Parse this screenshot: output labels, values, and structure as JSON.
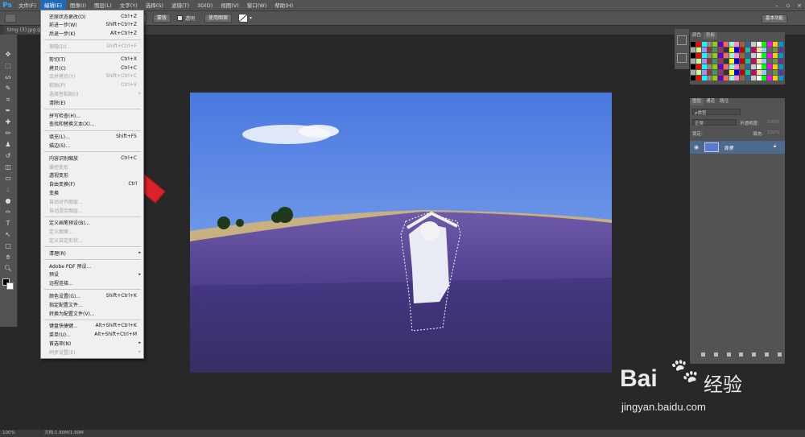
{
  "app": {
    "logo": "Ps",
    "window_controls": [
      "–",
      "▫",
      "×"
    ]
  },
  "menubar": [
    "文件(F)",
    "编辑(E)",
    "图像(I)",
    "图层(L)",
    "文字(Y)",
    "选择(S)",
    "滤镜(T)",
    "3D(D)",
    "视图(V)",
    "窗口(W)",
    "帮助(H)"
  ],
  "options": {
    "btn_blur": "调整边缘...",
    "mask": "蒙版",
    "invert": "反相",
    "tolerance": "透明",
    "use_grad": "使用图案",
    "workspace": "基本功能"
  },
  "document_tab": "timg (3).jpg @ ",
  "status": {
    "zoom": "100%",
    "doc": "文档:1.90M/1.90M"
  },
  "edit_menu": [
    {
      "label": "还原状态更改(O)",
      "shortcut": "Ctrl+Z",
      "disabled": false
    },
    {
      "label": "前进一步(W)",
      "shortcut": "Shift+Ctrl+Z",
      "disabled": false
    },
    {
      "label": "后退一步(K)",
      "shortcut": "Alt+Ctrl+Z",
      "disabled": false
    },
    {
      "sep": true
    },
    {
      "label": "渐隐(D)...",
      "shortcut": "Shift+Ctrl+F",
      "disabled": true
    },
    {
      "sep": true
    },
    {
      "label": "剪切(T)",
      "shortcut": "Ctrl+X",
      "disabled": false
    },
    {
      "label": "拷贝(C)",
      "shortcut": "Ctrl+C",
      "disabled": false
    },
    {
      "label": "合并拷贝(Y)",
      "shortcut": "Shift+Ctrl+C",
      "disabled": true
    },
    {
      "label": "粘贴(P)",
      "shortcut": "Ctrl+V",
      "disabled": true
    },
    {
      "label": "选择性粘贴(I)",
      "shortcut": "",
      "disabled": true,
      "sub": true
    },
    {
      "label": "清除(E)",
      "shortcut": "",
      "disabled": false
    },
    {
      "sep": true
    },
    {
      "label": "拼写检查(H)...",
      "shortcut": "",
      "disabled": false
    },
    {
      "label": "查找和替换文本(X)...",
      "shortcut": "",
      "disabled": false
    },
    {
      "sep": true
    },
    {
      "label": "填充(L)...",
      "shortcut": "Shift+F5",
      "disabled": false
    },
    {
      "label": "描边(S)...",
      "shortcut": "",
      "disabled": false
    },
    {
      "sep": true
    },
    {
      "label": "内容识别缩放",
      "shortcut": "Ctrl+C",
      "disabled": false
    },
    {
      "label": "操控变形",
      "shortcut": "",
      "disabled": true
    },
    {
      "label": "透视变形",
      "shortcut": "",
      "disabled": false
    },
    {
      "label": "自由变换(F)",
      "shortcut": "Ctrl",
      "disabled": false
    },
    {
      "label": "变换",
      "shortcut": "",
      "disabled": false
    },
    {
      "label": "自动对齐图层...",
      "shortcut": "",
      "disabled": true
    },
    {
      "label": "自动混合图层...",
      "shortcut": "",
      "disabled": true
    },
    {
      "sep": true
    },
    {
      "label": "定义画笔预设(B)...",
      "shortcut": "",
      "disabled": false
    },
    {
      "label": "定义图案...",
      "shortcut": "",
      "disabled": true
    },
    {
      "label": "定义自定形状...",
      "shortcut": "",
      "disabled": true
    },
    {
      "sep": true
    },
    {
      "label": "清理(R)",
      "shortcut": "",
      "disabled": false,
      "sub": true
    },
    {
      "sep": true
    },
    {
      "label": "Adobe PDF 预设...",
      "shortcut": "",
      "disabled": false
    },
    {
      "label": "预设",
      "shortcut": "",
      "disabled": false,
      "sub": true
    },
    {
      "label": "远程连接...",
      "shortcut": "",
      "disabled": false
    },
    {
      "sep": true
    },
    {
      "label": "颜色设置(G)...",
      "shortcut": "Shift+Ctrl+K",
      "disabled": false
    },
    {
      "label": "指定配置文件...",
      "shortcut": "",
      "disabled": false
    },
    {
      "label": "转换为配置文件(V)...",
      "shortcut": "",
      "disabled": false
    },
    {
      "sep": true
    },
    {
      "label": "键盘快捷键...",
      "shortcut": "Alt+Shift+Ctrl+K",
      "disabled": false
    },
    {
      "label": "菜单(U)...",
      "shortcut": "Alt+Shift+Ctrl+M",
      "disabled": false
    },
    {
      "label": "首选项(N)",
      "shortcut": "",
      "disabled": false,
      "sub": true
    },
    {
      "label": "同步设置(E)",
      "shortcut": "",
      "disabled": true,
      "sub": true
    }
  ],
  "swatches_panel": {
    "tabs": [
      "颜色",
      "色板"
    ]
  },
  "layers_panel": {
    "tabs": [
      "图层",
      "通道",
      "路径"
    ],
    "kind": "ρ类型",
    "blend": "正常",
    "opacity_label": "不透明度:",
    "opacity": "100%",
    "lock_label": "锁定:",
    "fill_label": "填充:",
    "fill": "100%",
    "layer_name": "背景"
  },
  "watermark": {
    "brand": "Bai",
    "brand2": "经验",
    "url": "jingyan.baidu.com"
  },
  "colors": {
    "menu_highlight": "#1f6bb8",
    "arrow": "#d9222a",
    "layer_selected": "#4c6a8e"
  }
}
